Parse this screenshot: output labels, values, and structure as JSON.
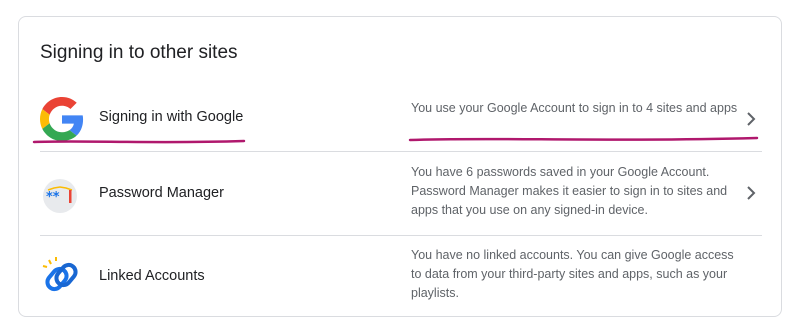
{
  "section": {
    "title": "Signing in to other sites"
  },
  "rows": [
    {
      "label": "Signing in with Google",
      "description": "You use your Google Account to sign in to 4 sites and apps",
      "icon": "google-g-icon",
      "has_chevron": true
    },
    {
      "label": "Password Manager",
      "description": "You have 6 passwords saved in your Google Account. Password Manager makes it easier to sign in to sites and apps that you use on any signed-in device.",
      "icon": "password-manager-icon",
      "has_chevron": true
    },
    {
      "label": "Linked Accounts",
      "description": "You have no linked accounts. You can give Google access to data from your third-party sites and apps, such as your playlists.",
      "icon": "linked-accounts-icon",
      "has_chevron": false
    }
  ],
  "colors": {
    "underline_annotation": "#b0186d",
    "divider": "#dadce0",
    "google_blue": "#4285f4",
    "google_red": "#ea4335",
    "google_yellow": "#fbbc05",
    "google_green": "#34a853"
  }
}
